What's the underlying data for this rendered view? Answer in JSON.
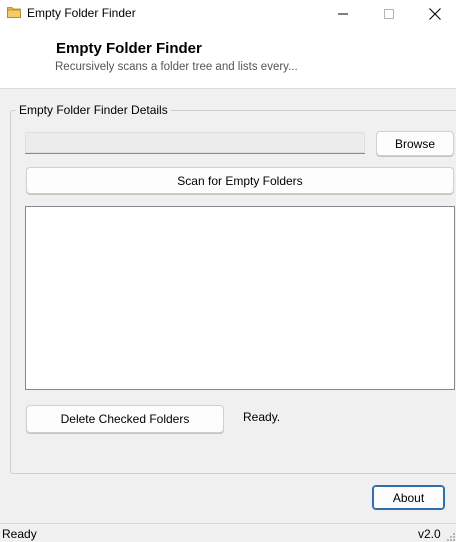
{
  "window": {
    "title": "Empty Folder Finder",
    "icon": "folder-icon"
  },
  "header": {
    "title": "Empty Folder Finder",
    "subtitle": "Recursively scans a folder tree and lists every..."
  },
  "group": {
    "label": "Empty Folder Finder Details",
    "path_value": "",
    "browse_label": "Browse",
    "scan_label": "Scan for Empty Folders",
    "results": [],
    "delete_label": "Delete Checked Folders",
    "scan_status": "Ready."
  },
  "footer": {
    "about_label": "About"
  },
  "statusbar": {
    "left": "Ready",
    "right": "v2.0"
  },
  "colors": {
    "accent_border": "#2f6fb0",
    "folder_icon": "#e8b84a"
  }
}
